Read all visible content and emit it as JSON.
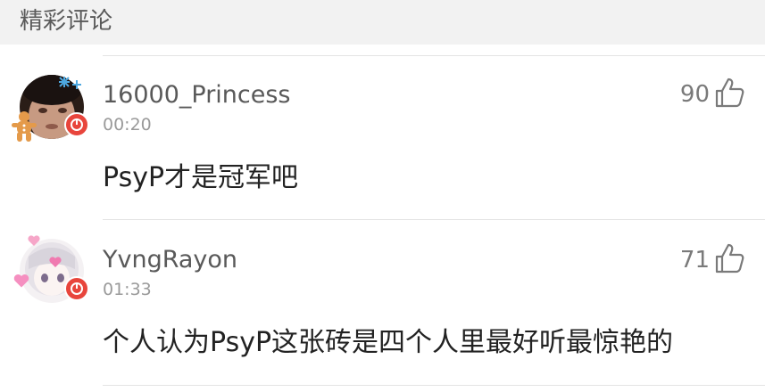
{
  "section": {
    "title": "精彩评论"
  },
  "comments": [
    {
      "username": "16000_Princess",
      "time": "00:20",
      "likes": "90",
      "text": "PsyP才是冠军吧",
      "avatar_icon": "avatar-photo",
      "badge_icon": "music-badge-icon"
    },
    {
      "username": "YvngRayon",
      "time": "01:33",
      "likes": "71",
      "text": "个人认为PsyP这张砖是四个人里最好听最惊艳的",
      "avatar_icon": "avatar-anime",
      "badge_icon": "music-badge-icon"
    }
  ],
  "colors": {
    "header_bg": "#f2f2f2",
    "badge_red": "#e8453c",
    "username": "#595959",
    "time": "#9a9a9a",
    "text": "#222222"
  }
}
